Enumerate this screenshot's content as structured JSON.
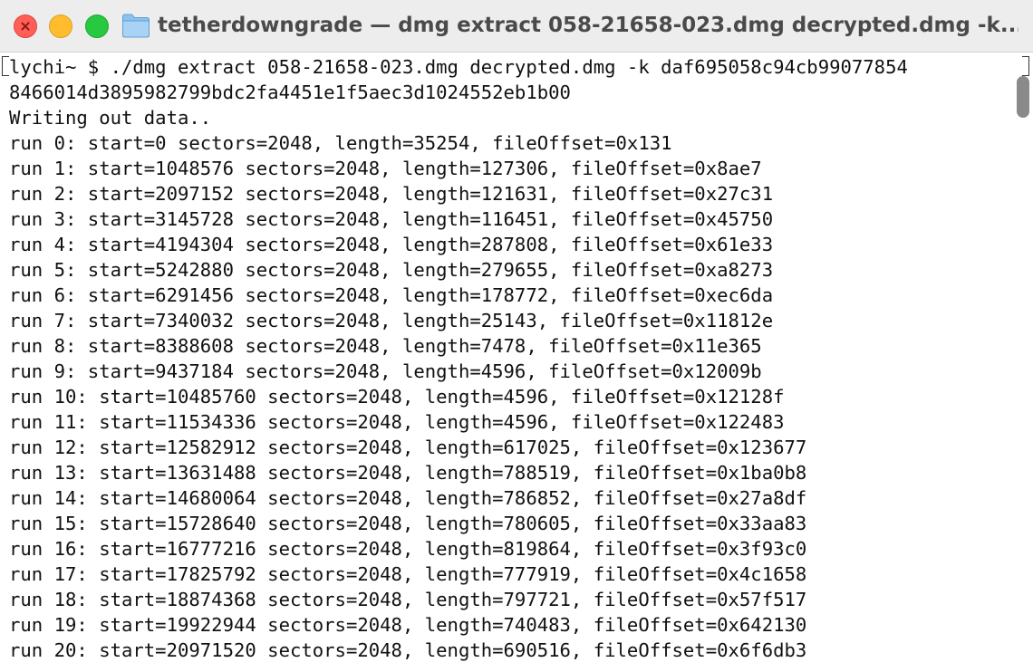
{
  "window": {
    "title": "tetherdowngrade — dmg extract 058-21658-023.dmg decrypted.dmg -k..."
  },
  "icons": {
    "close": "close-icon",
    "minimize": "minimize-icon",
    "zoom": "zoom-icon",
    "folder": "folder-icon"
  },
  "colors": {
    "close": "#ff5f57",
    "minimize": "#febc2e",
    "zoom": "#28c840",
    "folder": "#7fb8e8"
  },
  "terminal": {
    "lines": [
      "lychi~ $ ./dmg extract 058-21658-023.dmg decrypted.dmg -k daf695058c94cb99077854",
      "8466014d3895982799bdc2fa4451e1f5aec3d1024552eb1b00",
      "Writing out data..",
      "run 0: start=0 sectors=2048, length=35254, fileOffset=0x131",
      "run 1: start=1048576 sectors=2048, length=127306, fileOffset=0x8ae7",
      "run 2: start=2097152 sectors=2048, length=121631, fileOffset=0x27c31",
      "run 3: start=3145728 sectors=2048, length=116451, fileOffset=0x45750",
      "run 4: start=4194304 sectors=2048, length=287808, fileOffset=0x61e33",
      "run 5: start=5242880 sectors=2048, length=279655, fileOffset=0xa8273",
      "run 6: start=6291456 sectors=2048, length=178772, fileOffset=0xec6da",
      "run 7: start=7340032 sectors=2048, length=25143, fileOffset=0x11812e",
      "run 8: start=8388608 sectors=2048, length=7478, fileOffset=0x11e365",
      "run 9: start=9437184 sectors=2048, length=4596, fileOffset=0x12009b",
      "run 10: start=10485760 sectors=2048, length=4596, fileOffset=0x12128f",
      "run 11: start=11534336 sectors=2048, length=4596, fileOffset=0x122483",
      "run 12: start=12582912 sectors=2048, length=617025, fileOffset=0x123677",
      "run 13: start=13631488 sectors=2048, length=788519, fileOffset=0x1ba0b8",
      "run 14: start=14680064 sectors=2048, length=786852, fileOffset=0x27a8df",
      "run 15: start=15728640 sectors=2048, length=780605, fileOffset=0x33aa83",
      "run 16: start=16777216 sectors=2048, length=819864, fileOffset=0x3f93c0",
      "run 17: start=17825792 sectors=2048, length=777919, fileOffset=0x4c1658",
      "run 18: start=18874368 sectors=2048, length=797721, fileOffset=0x57f517",
      "run 19: start=19922944 sectors=2048, length=740483, fileOffset=0x642130",
      "run 20: start=20971520 sectors=2048, length=690516, fileOffset=0x6f6db3"
    ]
  }
}
